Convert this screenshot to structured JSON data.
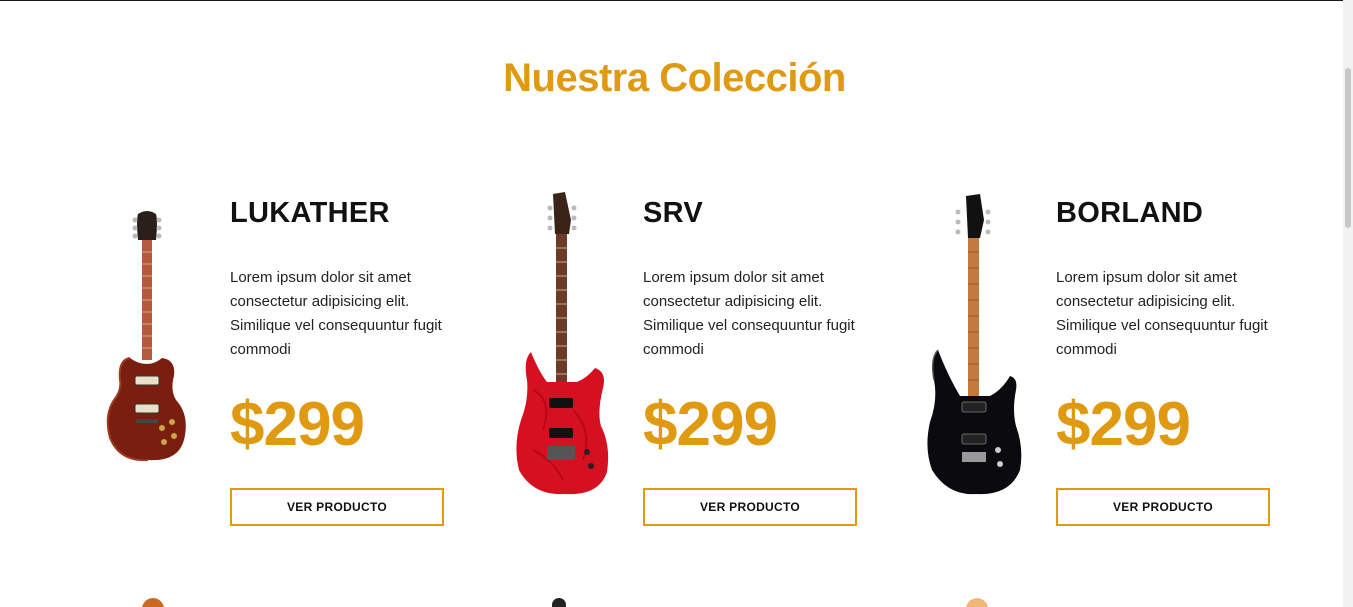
{
  "section": {
    "title": "Nuestra Colección"
  },
  "products": [
    {
      "name": "LUKATHER",
      "description": "Lorem ipsum dolor sit amet consectetur adipisicing elit. Similique vel consequuntur fugit commodi",
      "price": "$299",
      "button_label": "VER PRODUCTO",
      "image": "les-paul-guitar-red"
    },
    {
      "name": "SRV",
      "description": "Lorem ipsum dolor sit amet consectetur adipisicing elit. Similique vel consequuntur fugit commodi",
      "price": "$299",
      "button_label": "VER PRODUCTO",
      "image": "superstrat-guitar-red-quilt"
    },
    {
      "name": "BORLAND",
      "description": "Lorem ipsum dolor sit amet consectetur adipisicing elit. Similique vel consequuntur fugit commodi",
      "price": "$299",
      "button_label": "VER PRODUCTO",
      "image": "superstrat-guitar-black"
    }
  ],
  "colors": {
    "accent": "#e09a12",
    "text": "#111111",
    "background": "#ffffff"
  }
}
